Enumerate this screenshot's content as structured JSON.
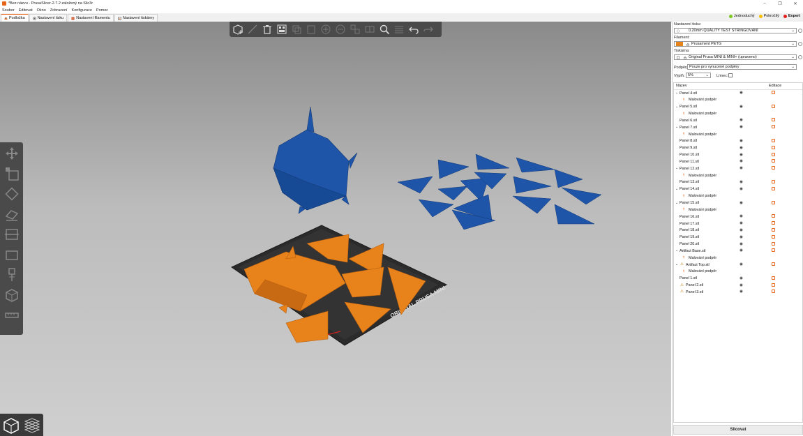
{
  "window": {
    "title": "*Bez názvu - PrusaSlicer-2.7.2 založený na Slic3r",
    "controls": [
      "–",
      "❐",
      "✕"
    ]
  },
  "menu": [
    "Soubor",
    "Editovat",
    "Okno",
    "Zobrazení",
    "Konfigurace",
    "Pomoc"
  ],
  "tabs": [
    {
      "label": "Podložka",
      "active": true
    },
    {
      "label": "Nastavení tisku",
      "active": false
    },
    {
      "label": "Nastavení filamentu",
      "active": false
    },
    {
      "label": "Nastavení tiskárny",
      "active": false
    }
  ],
  "modes": [
    {
      "label": "Jednoduchý",
      "color": "#7ec820"
    },
    {
      "label": "Pokročilý",
      "color": "#f5c000"
    },
    {
      "label": "Expert",
      "color": "#e02020",
      "active": true
    }
  ],
  "sidebar": {
    "print_settings_label": "Nastavení tisku:",
    "print_settings_value": "0.20mm QUALITY TEST STRINGOVÁNÍ",
    "filament_label": "Filament:",
    "filament_value": "Prusament PETG",
    "filament_color": "#e8821a",
    "printer_label": "Tiskárna:",
    "printer_value": "Original Prusa MINI & MINI+ (upraveno)",
    "supports_label": "Podpěry:",
    "supports_value": "Pouze pro vynucené podpěry",
    "infill_label": "Výplň:",
    "infill_value": "5%",
    "brim_label": "Límec:",
    "col_name": "Název",
    "col_edit": "Editace",
    "objects": [
      {
        "name": "Panel 4.stl",
        "expanded": true,
        "sub": "Malování podpěr"
      },
      {
        "name": "Panel 5.stl",
        "expanded": true,
        "sub": "Malování podpěr"
      },
      {
        "name": "Panel 6.stl"
      },
      {
        "name": "Panel 7.stl",
        "expanded": true,
        "sub": "Malování podpěr"
      },
      {
        "name": "Panel 8.stl"
      },
      {
        "name": "Panel 9.stl"
      },
      {
        "name": "Panel 10.stl"
      },
      {
        "name": "Panel 11.stl"
      },
      {
        "name": "Panel 12.stl",
        "expanded": true,
        "sub": "Malování podpěr"
      },
      {
        "name": "Panel 13.stl"
      },
      {
        "name": "Panel 14.stl",
        "expanded": true,
        "sub": "Malování podpěr"
      },
      {
        "name": "Panel 15.stl",
        "expanded": true,
        "sub": "Malování podpěr"
      },
      {
        "name": "Panel 16.stl"
      },
      {
        "name": "Panel 17.stl"
      },
      {
        "name": "Panel 18.stl"
      },
      {
        "name": "Panel 19.stl"
      },
      {
        "name": "Panel 20.stl"
      },
      {
        "name": "Artifact Base.stl",
        "expanded": true,
        "sub": "Malování podpěr"
      },
      {
        "name": "Artifact Top.stl",
        "expanded": true,
        "warning": true,
        "sub": "Malování podpěr"
      },
      {
        "name": "Panel 1.stl"
      },
      {
        "name": "Panel 2.stl",
        "warning": true
      },
      {
        "name": "Panel 3.stl",
        "warning": true
      }
    ],
    "slice_button": "Slicovat"
  },
  "scene": {
    "bed_label": "ORIGINAL PRUSA MINI",
    "object_color": "#e8821a",
    "selected_color": "#1f55a8",
    "bed_color": "#2b2b2b"
  }
}
